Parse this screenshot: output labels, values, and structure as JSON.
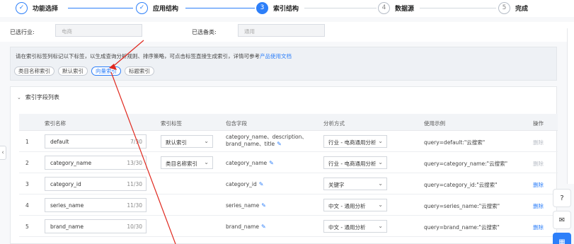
{
  "stepper": {
    "steps": [
      {
        "num": "✓",
        "label": "功能选择"
      },
      {
        "num": "✓",
        "label": "应用结构"
      },
      {
        "num": "3",
        "label": "索引结构"
      },
      {
        "num": "4",
        "label": "数据源"
      },
      {
        "num": "5",
        "label": "完成"
      }
    ]
  },
  "selection": {
    "industry_label": "已选行业:",
    "industry_value": "电商",
    "category_label": "已选备类:",
    "category_value": "通用"
  },
  "tag_panel": {
    "hint": "请在索引标签列标记以下标签，以生成查询分析规则、排序策略，可点击标签直接生成索引，详情可参考",
    "hint_link": "产品使用文档",
    "tags": [
      "类目名称索引",
      "默认索引",
      "向量索引",
      "标题索引"
    ]
  },
  "table_panel": {
    "title": "索引字段列表",
    "headers": {
      "name": "索引名称",
      "tag": "索引标签",
      "fields": "包含字段",
      "analyzer": "分析方式",
      "example": "使用示例",
      "action": "操作"
    },
    "rows": [
      {
        "num": "1",
        "name": "default",
        "count": "7/30",
        "tag": "默认索引",
        "fields": "category_name、description、brand_name、title",
        "analyzer": "行业 - 电商通用分析",
        "example": "query=default:\"云搜索\"",
        "action": "删除"
      },
      {
        "num": "2",
        "name": "category_name",
        "count": "13/30",
        "tag": "类目名称索引",
        "fields": "category_name",
        "analyzer": "行业 - 电商通用分析",
        "example": "query=category_name:\"云搜索\"",
        "action": "删除"
      },
      {
        "num": "3",
        "name": "category_id",
        "count": "11/30",
        "tag": "",
        "fields": "category_id",
        "analyzer": "关键字",
        "example": "query=category_id:\"云搜索\"",
        "action": "删除"
      },
      {
        "num": "4",
        "name": "series_name",
        "count": "11/30",
        "tag": "",
        "fields": "series_name",
        "analyzer": "中文 - 通用分析",
        "example": "query=series_name:\"云搜索\"",
        "action": "删除"
      },
      {
        "num": "5",
        "name": "brand_name",
        "count": "10/30",
        "tag": "",
        "fields": "brand_name",
        "analyzer": "中文 - 通用分析",
        "example": "query=brand_name:\"云搜索\"",
        "action": "删除"
      }
    ]
  },
  "float_buttons": {
    "help": "帮助",
    "feedback": "反馈",
    "contact": "联系"
  },
  "colors": {
    "primary": "#2d7ff9",
    "arrow": "#e0281e"
  }
}
